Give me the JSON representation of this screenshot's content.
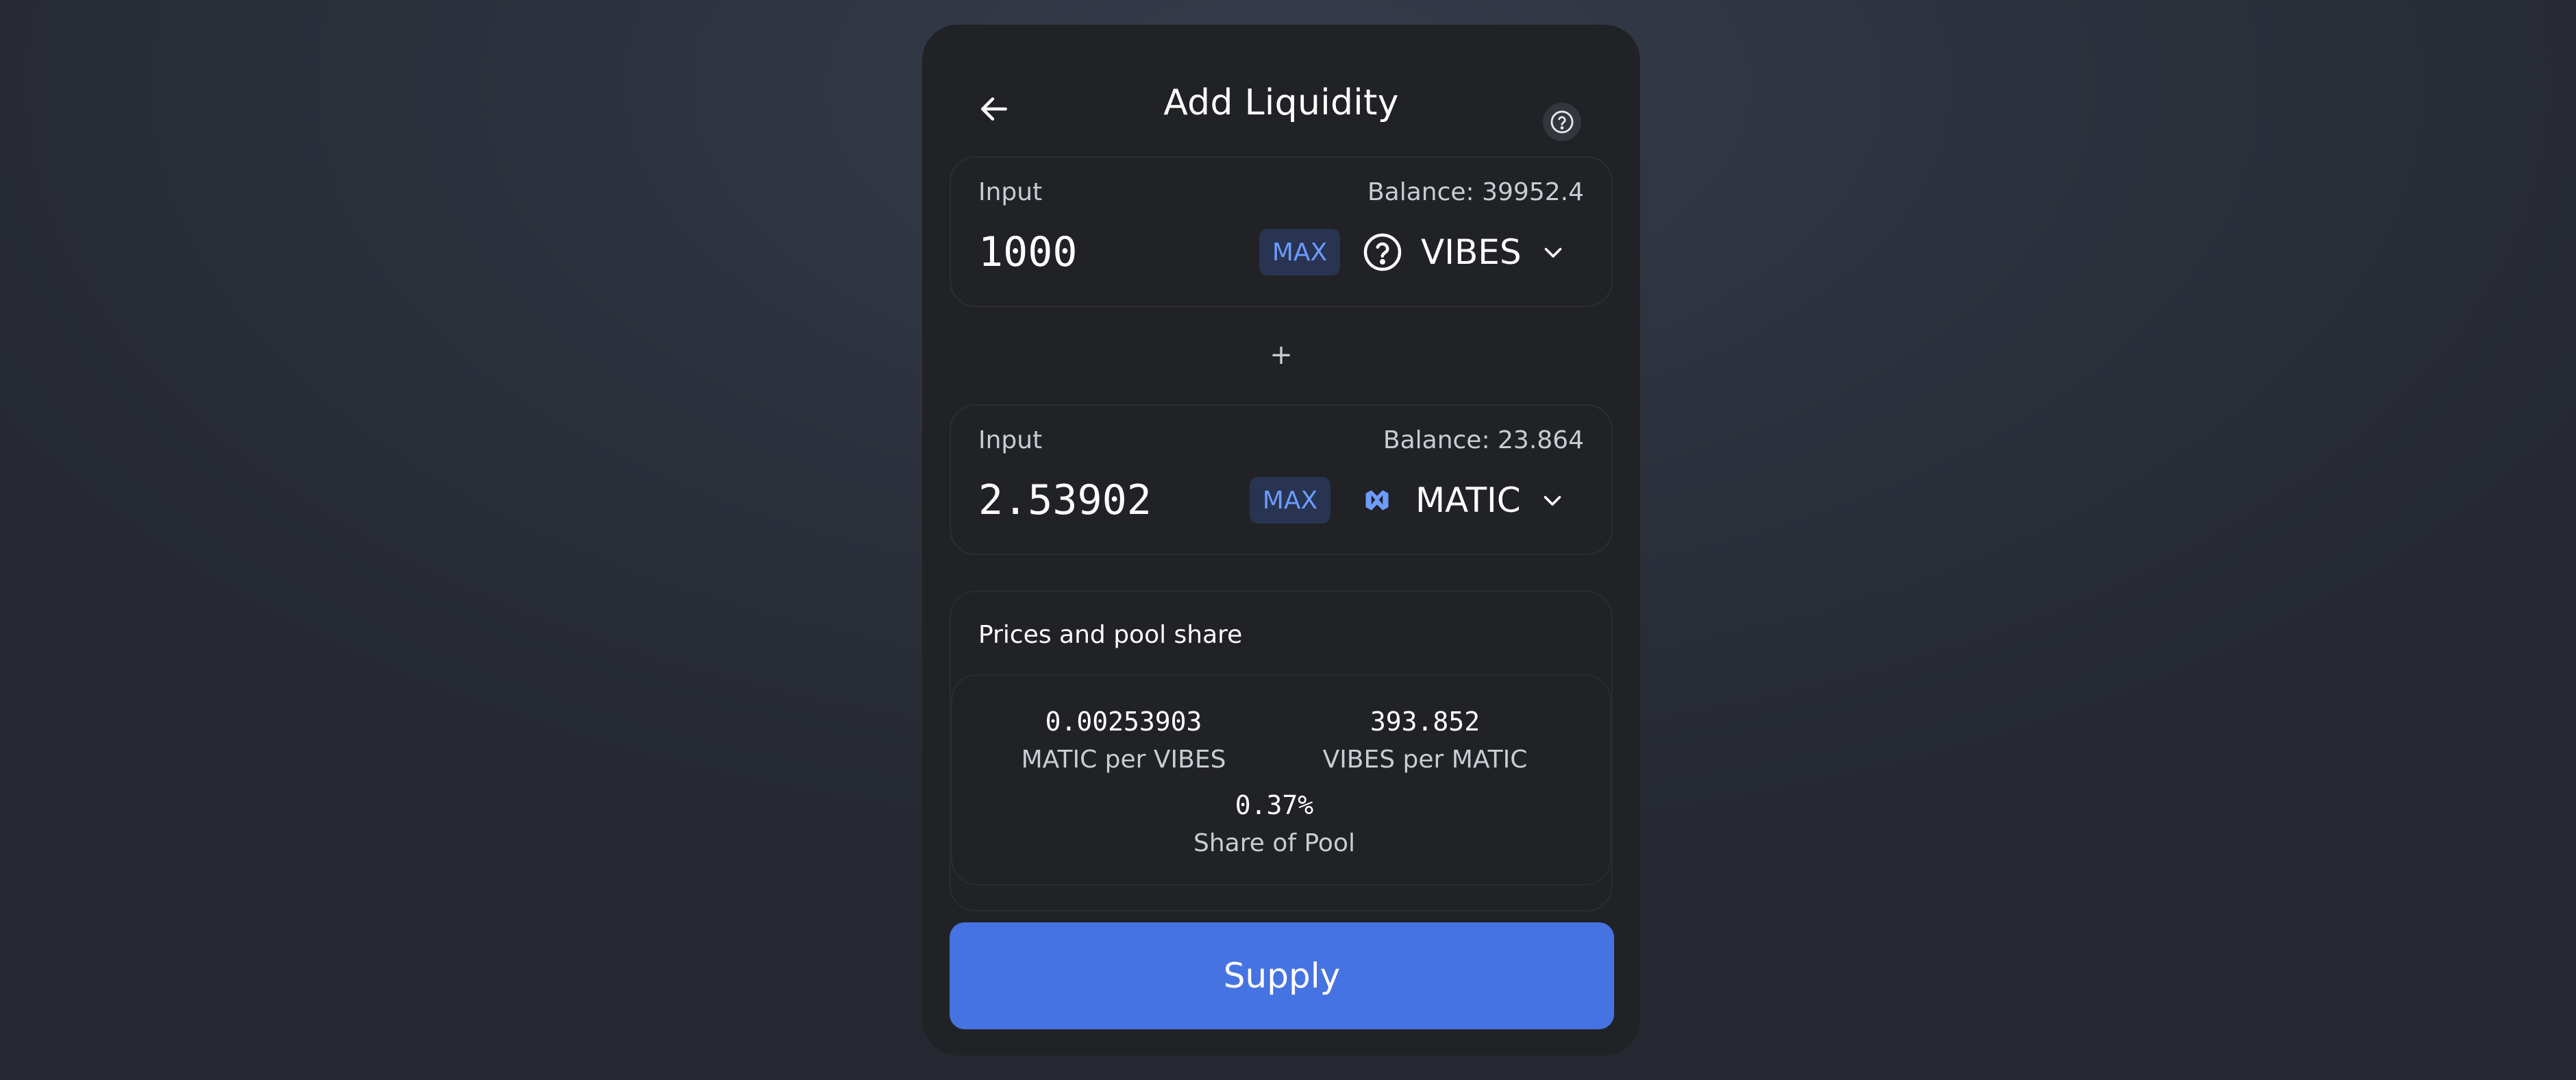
{
  "header": {
    "title": "Add Liquidity",
    "back_icon": "arrow-left-icon",
    "help_icon": "question-circle-icon"
  },
  "input_a": {
    "label": "Input",
    "balance": "Balance: 39952.4",
    "amount": "1000",
    "max_label": "MAX",
    "token": {
      "symbol": "VIBES",
      "icon": "unknown-token-icon"
    }
  },
  "separator": {
    "symbol": "+"
  },
  "input_b": {
    "label": "Input",
    "balance": "Balance: 23.864",
    "amount": "2.53902",
    "max_label": "MAX",
    "token": {
      "symbol": "MATIC",
      "icon": "matic-logo-icon"
    }
  },
  "prices": {
    "title": "Prices and pool share",
    "stats": [
      {
        "value": "0.00253903",
        "label": "MATIC per VIBES"
      },
      {
        "value": "393.852",
        "label": "VIBES per MATIC"
      },
      {
        "value": "0.37%",
        "label": "Share of Pool"
      }
    ]
  },
  "supply_button": {
    "label": "Supply"
  },
  "colors": {
    "accent": "#4673e2",
    "max_text": "#6d9bff",
    "max_bg": "#283452",
    "card_bg": "#212226"
  }
}
